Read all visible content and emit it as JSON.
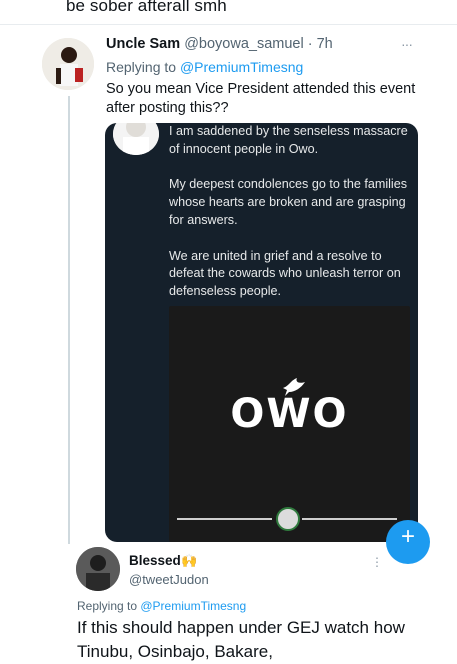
{
  "prev_tweet": {
    "text_tail": "be sober afterall smh"
  },
  "tweet1": {
    "name": "Uncle Sam",
    "handle": "@boyowa_samuel",
    "time": "· 7h",
    "more": "···",
    "replying_prefix": "Replying to ",
    "replying_handle": "@PremiumTimesng",
    "body": "So you mean Vice President attended this event after posting this??"
  },
  "embedded": {
    "para1": "I am saddened by the senseless massacre of innocent people in Owo.",
    "para2": "My deepest condolences go to the families whose hearts are broken and are grasping for answers.",
    "para3": "We are united in grief and a resolve to defeat the cowards who unleash terror on defenseless people.",
    "video_title": "OWO"
  },
  "tweet2": {
    "name": "Blessed",
    "emoji": "🙌",
    "handle": "@tweetJudon",
    "more": "⋮",
    "replying_prefix": "Replying to ",
    "replying_handle": "@PremiumTimesng",
    "body": "If this should happen under GEJ watch how Tinubu, Osinbajo, Bakare,"
  },
  "colors": {
    "link": "#1d9bf0",
    "muted": "#536471",
    "dark_card": "#15202b"
  }
}
